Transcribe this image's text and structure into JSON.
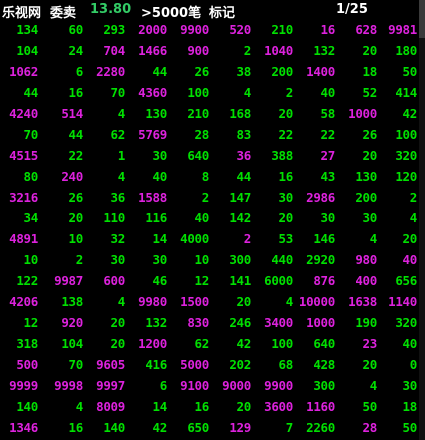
{
  "header": {
    "title": "乐视网",
    "side": "委卖",
    "price": "13.80",
    "filter": ">5000笔",
    "mark": "标记",
    "page": "1/25"
  },
  "colors": {
    "background": "#000000",
    "green": "#00e000",
    "magenta": "#dd22dd",
    "price": "#33cc66"
  },
  "rows": [
    {
      "v": [
        "134",
        "60",
        "293",
        "2000",
        "9900",
        "520",
        "210",
        "16",
        "628",
        "9981"
      ],
      "c": "gggmmmgmmm"
    },
    {
      "v": [
        "104",
        "24",
        "704",
        "1466",
        "900",
        "2",
        "1040",
        "132",
        "20",
        "180"
      ],
      "c": "ggmmmgmggg"
    },
    {
      "v": [
        "1062",
        "6",
        "2280",
        "44",
        "26",
        "38",
        "200",
        "1400",
        "18",
        "50"
      ],
      "c": "mgmggggmgg"
    },
    {
      "v": [
        "44",
        "16",
        "70",
        "4360",
        "100",
        "4",
        "2",
        "40",
        "52",
        "414"
      ],
      "c": "gggmgggggg"
    },
    {
      "v": [
        "4240",
        "514",
        "4",
        "130",
        "210",
        "168",
        "20",
        "58",
        "1000",
        "42"
      ],
      "c": "mmggggggmg"
    },
    {
      "v": [
        "70",
        "44",
        "62",
        "5769",
        "28",
        "83",
        "22",
        "22",
        "26",
        "100"
      ],
      "c": "gggmgggggg"
    },
    {
      "v": [
        "4515",
        "22",
        "1",
        "30",
        "640",
        "36",
        "388",
        "27",
        "20",
        "320"
      ],
      "c": "mggggmgmgggg"
    },
    {
      "v": [
        "80",
        "240",
        "4",
        "40",
        "8",
        "44",
        "16",
        "43",
        "130",
        "120"
      ],
      "c": "gmgggggggg"
    },
    {
      "v": [
        "3216",
        "26",
        "36",
        "1588",
        "2",
        "147",
        "30",
        "2986",
        "200",
        "2"
      ],
      "c": "mggmgggmgg"
    },
    {
      "v": [
        "34",
        "20",
        "110",
        "116",
        "40",
        "142",
        "20",
        "30",
        "30",
        "4"
      ],
      "c": "gggggggggg"
    },
    {
      "v": [
        "4891",
        "10",
        "32",
        "14",
        "4000",
        "2",
        "53",
        "146",
        "4",
        "20"
      ],
      "c": "mggggmgggg"
    },
    {
      "v": [
        "10",
        "2",
        "30",
        "30",
        "10",
        "300",
        "440",
        "2920",
        "980",
        "40"
      ],
      "c": "ggggggggmmg"
    },
    {
      "v": [
        "122",
        "9987",
        "600",
        "46",
        "12",
        "141",
        "6000",
        "876",
        "400",
        "656"
      ],
      "c": "gmmggggmmgm"
    },
    {
      "v": [
        "4206",
        "138",
        "4",
        "9980",
        "1500",
        "20",
        "4",
        "10000",
        "1638",
        "1140"
      ],
      "c": "mggmmggmmm"
    },
    {
      "v": [
        "12",
        "920",
        "20",
        "132",
        "830",
        "246",
        "3400",
        "1000",
        "190",
        "320"
      ],
      "c": "gmggmgmmgg"
    },
    {
      "v": [
        "318",
        "104",
        "20",
        "1200",
        "62",
        "42",
        "100",
        "640",
        "23",
        "40"
      ],
      "c": "gggmggggmgg"
    },
    {
      "v": [
        "500",
        "70",
        "9605",
        "416",
        "5000",
        "202",
        "68",
        "428",
        "20",
        "0"
      ],
      "c": "mgmgmggggg"
    },
    {
      "v": [
        "9999",
        "9998",
        "9997",
        "6",
        "9100",
        "9000",
        "9900",
        "300",
        "4",
        "30"
      ],
      "c": "mmmgmmmggg"
    },
    {
      "v": [
        "140",
        "4",
        "8009",
        "14",
        "16",
        "20",
        "3600",
        "1160",
        "50",
        "18"
      ],
      "c": "ggmgggmmgg"
    },
    {
      "v": [
        "1346",
        "16",
        "140",
        "42",
        "650",
        "129",
        "7",
        "2260",
        "28",
        "50"
      ],
      "c": "mggggmggmgg"
    }
  ]
}
